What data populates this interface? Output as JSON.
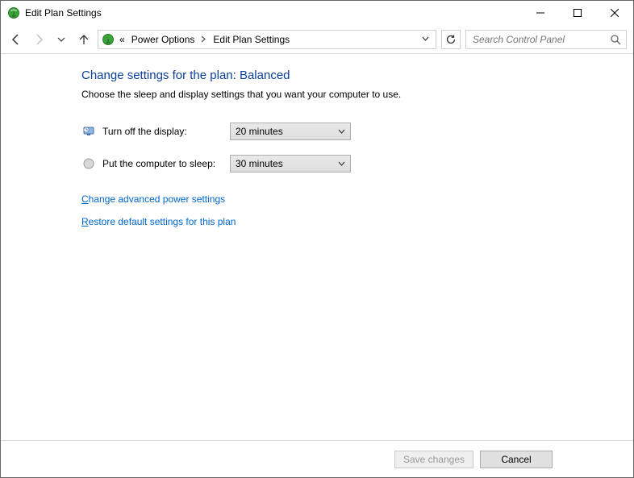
{
  "window": {
    "title": "Edit Plan Settings"
  },
  "breadcrumb": {
    "root_prefix": "«",
    "items": [
      "Power Options",
      "Edit Plan Settings"
    ]
  },
  "search": {
    "placeholder": "Search Control Panel"
  },
  "main": {
    "heading": "Change settings for the plan: Balanced",
    "subtext": "Choose the sleep and display settings that you want your computer to use.",
    "settings": {
      "display_label": "Turn off the display:",
      "display_value": "20 minutes",
      "sleep_label": "Put the computer to sleep:",
      "sleep_value": "30 minutes"
    },
    "links": {
      "advanced": "hange advanced power settings",
      "advanced_accel": "C",
      "restore": "estore default settings for this plan",
      "restore_accel": "R"
    }
  },
  "footer": {
    "save_label": "Save changes",
    "cancel_label": "Cancel"
  }
}
